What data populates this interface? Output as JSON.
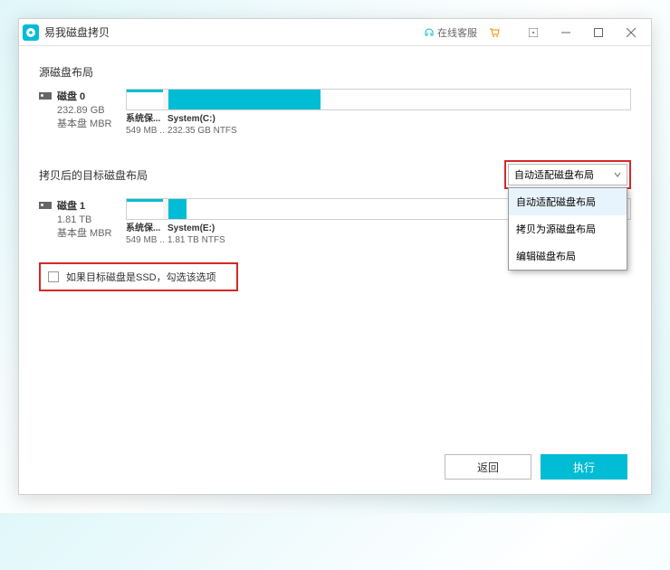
{
  "titlebar": {
    "app_name": "易我磁盘拷贝",
    "support_text": "在线客服"
  },
  "source": {
    "section_label": "源磁盘布局",
    "disk_name": "磁盘 0",
    "disk_size": "232.89 GB",
    "disk_type": "基本盘 MBR",
    "partitions": {
      "reserved": {
        "label": "系统保...",
        "size": "549 MB .."
      },
      "system": {
        "label": "System(C:)",
        "size": "232.35 GB NTFS"
      }
    }
  },
  "target": {
    "section_label": "拷贝后的目标磁盘布局",
    "disk_name": "磁盘 1",
    "disk_size": "1.81 TB",
    "disk_type": "基本盘 MBR",
    "partitions": {
      "reserved": {
        "label": "系统保...",
        "size": "549 MB .."
      },
      "system": {
        "label": "System(E:)",
        "size": "1.81 TB NTFS"
      }
    }
  },
  "dropdown": {
    "selected": "自动适配磁盘布局",
    "options": [
      "自动适配磁盘布局",
      "拷贝为源磁盘布局",
      "编辑磁盘布局"
    ]
  },
  "ssd_checkbox": {
    "label": "如果目标磁盘是SSD，勾选该选项"
  },
  "footer": {
    "back": "返回",
    "execute": "执行"
  }
}
